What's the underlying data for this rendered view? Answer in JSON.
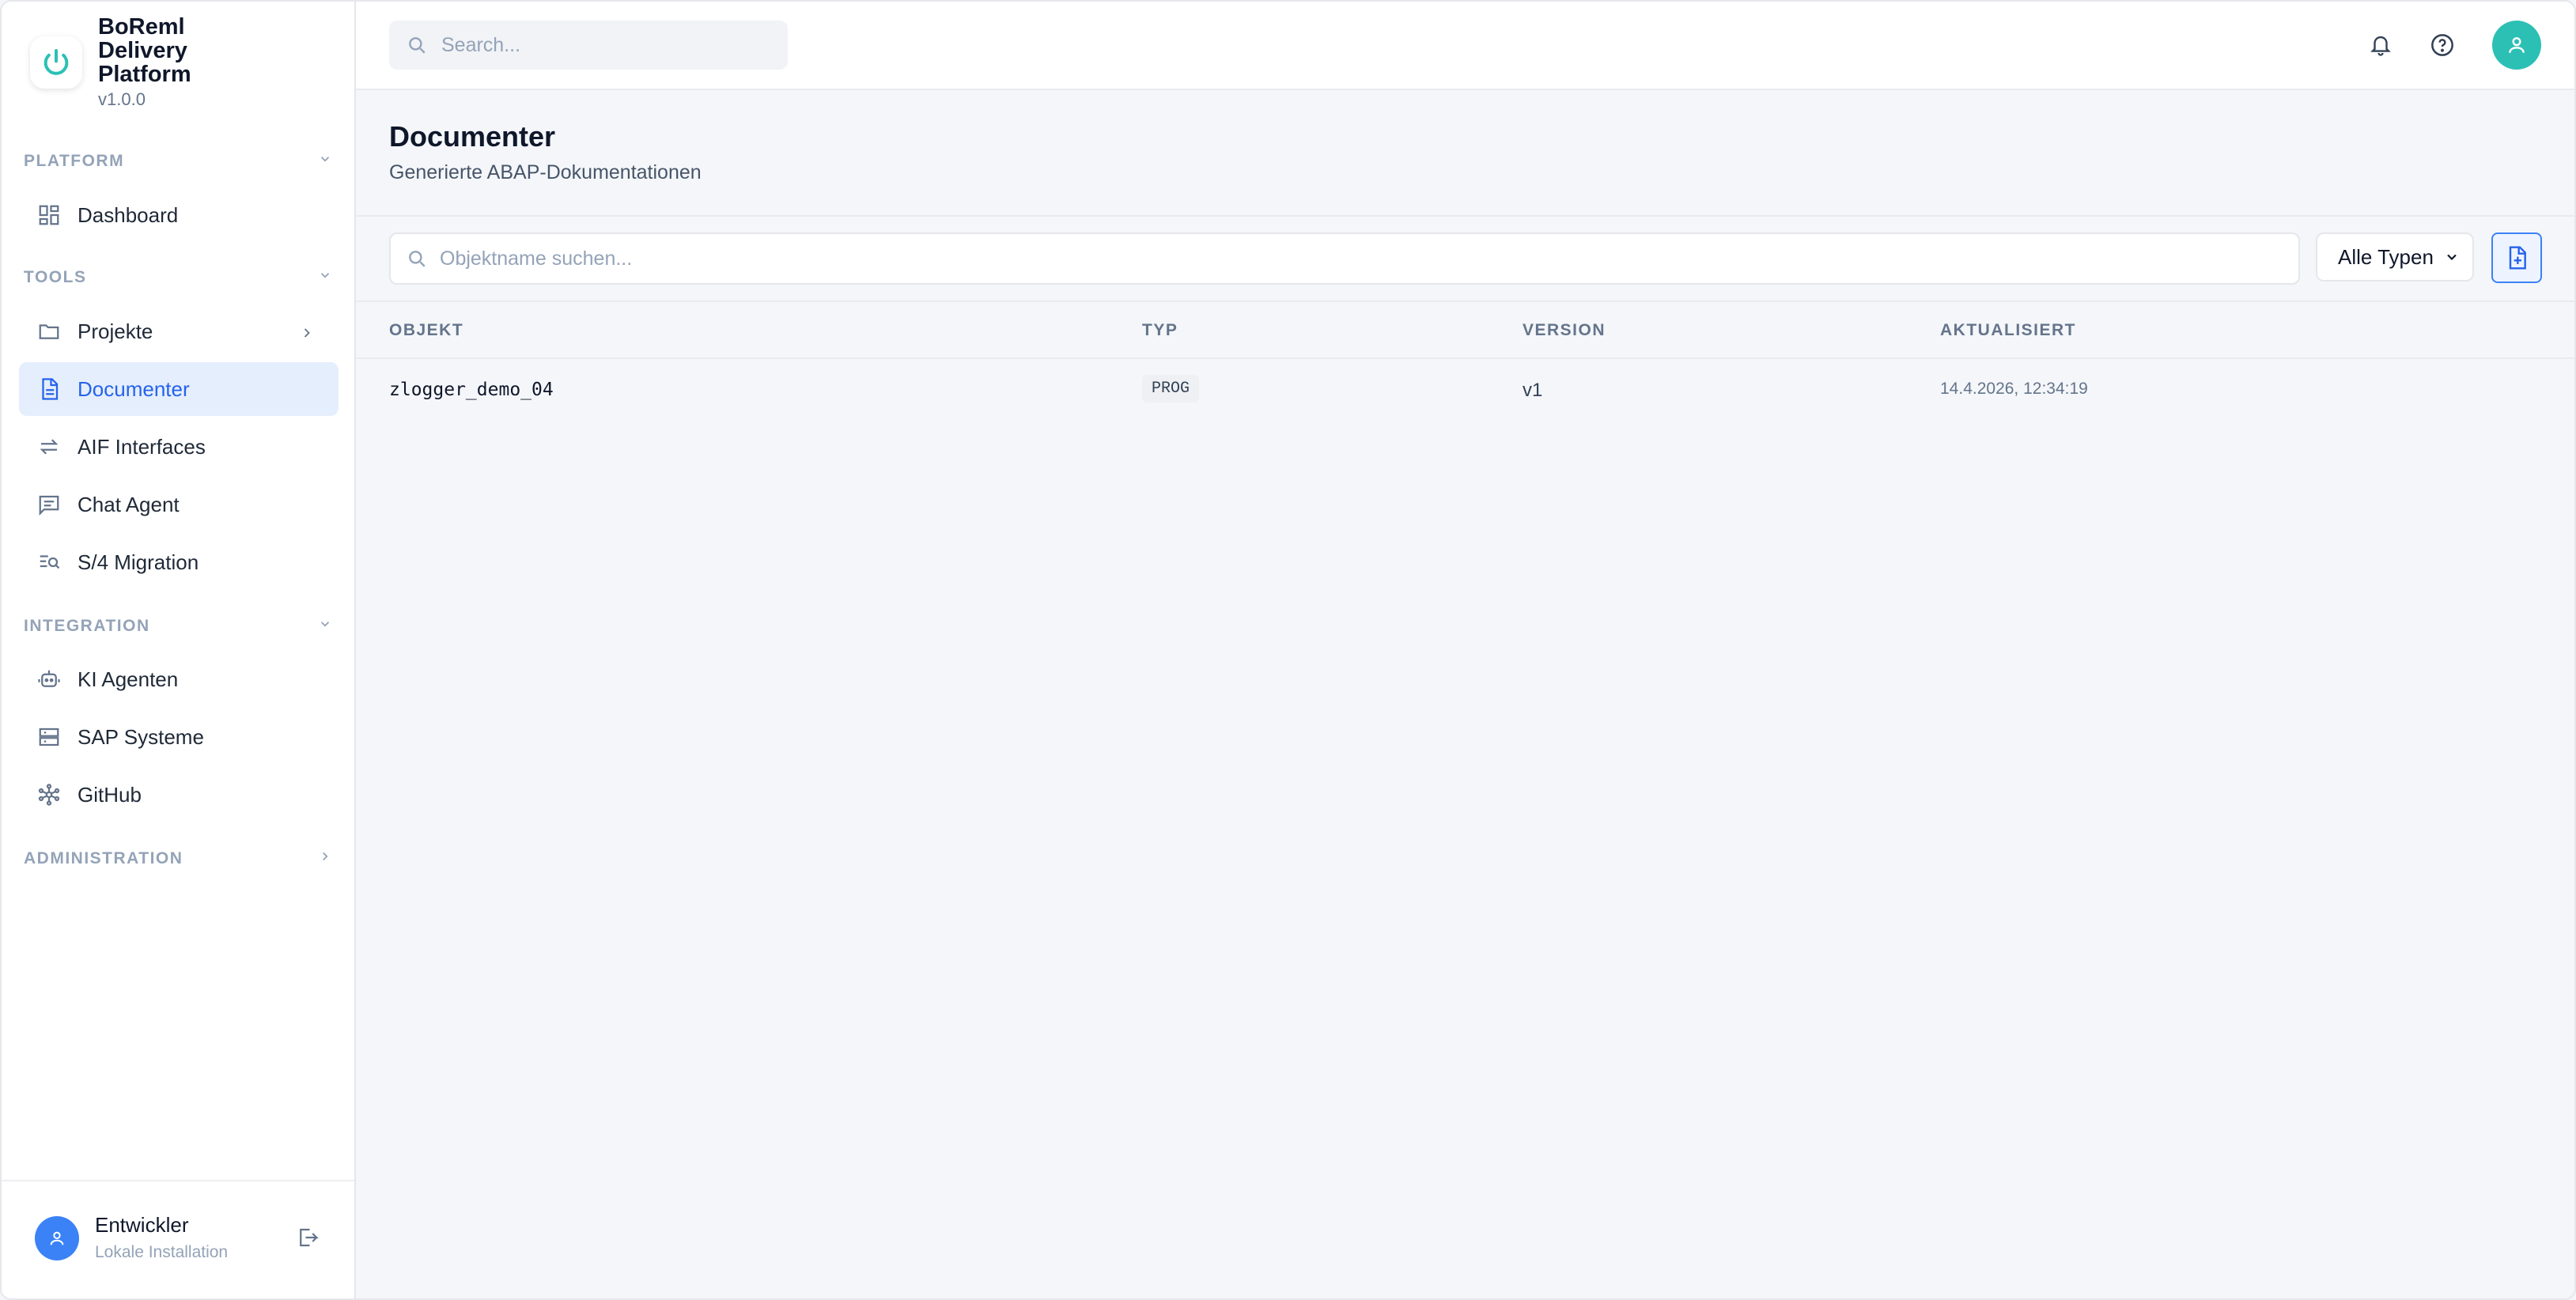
{
  "app": {
    "title": "BoReml Delivery Platform",
    "version": "v1.0.0"
  },
  "sidebar": {
    "sections": [
      {
        "label": "PLATFORM",
        "items": [
          {
            "label": "Dashboard",
            "icon": "dashboard-icon"
          }
        ]
      },
      {
        "label": "TOOLS",
        "items": [
          {
            "label": "Projekte",
            "icon": "folder-icon"
          },
          {
            "label": "Documenter",
            "icon": "document-icon",
            "active": true
          },
          {
            "label": "AIF Interfaces",
            "icon": "arrows-exchange-icon"
          },
          {
            "label": "Chat Agent",
            "icon": "chat-icon"
          },
          {
            "label": "S/4 Migration",
            "icon": "list-search-icon"
          }
        ]
      },
      {
        "label": "INTEGRATION",
        "items": [
          {
            "label": "KI Agenten",
            "icon": "robot-icon"
          },
          {
            "label": "SAP Systeme",
            "icon": "server-icon"
          },
          {
            "label": "GitHub",
            "icon": "network-icon"
          }
        ]
      },
      {
        "label": "ADMINISTRATION",
        "items": []
      }
    ],
    "user": {
      "name": "Entwickler",
      "subtitle": "Lokale Installation"
    }
  },
  "topbar": {
    "search_placeholder": "Search..."
  },
  "page": {
    "title": "Documenter",
    "subtitle": "Generierte ABAP-Dokumentationen"
  },
  "filters": {
    "search_placeholder": "Objektname suchen...",
    "type_select": "Alle Typen"
  },
  "table": {
    "columns": [
      "OBJEKT",
      "TYP",
      "VERSION",
      "AKTUALISIERT"
    ],
    "rows": [
      {
        "objekt": "zlogger_demo_04",
        "typ": "PROG",
        "version": "v1",
        "aktualisiert": "14.4.2026, 12:34:19"
      }
    ]
  },
  "colors": {
    "accent": "#2563eb",
    "active_bg": "#e5eefc",
    "avatar_teal": "#2cc0b5",
    "avatar_blue": "#3b82f6"
  }
}
